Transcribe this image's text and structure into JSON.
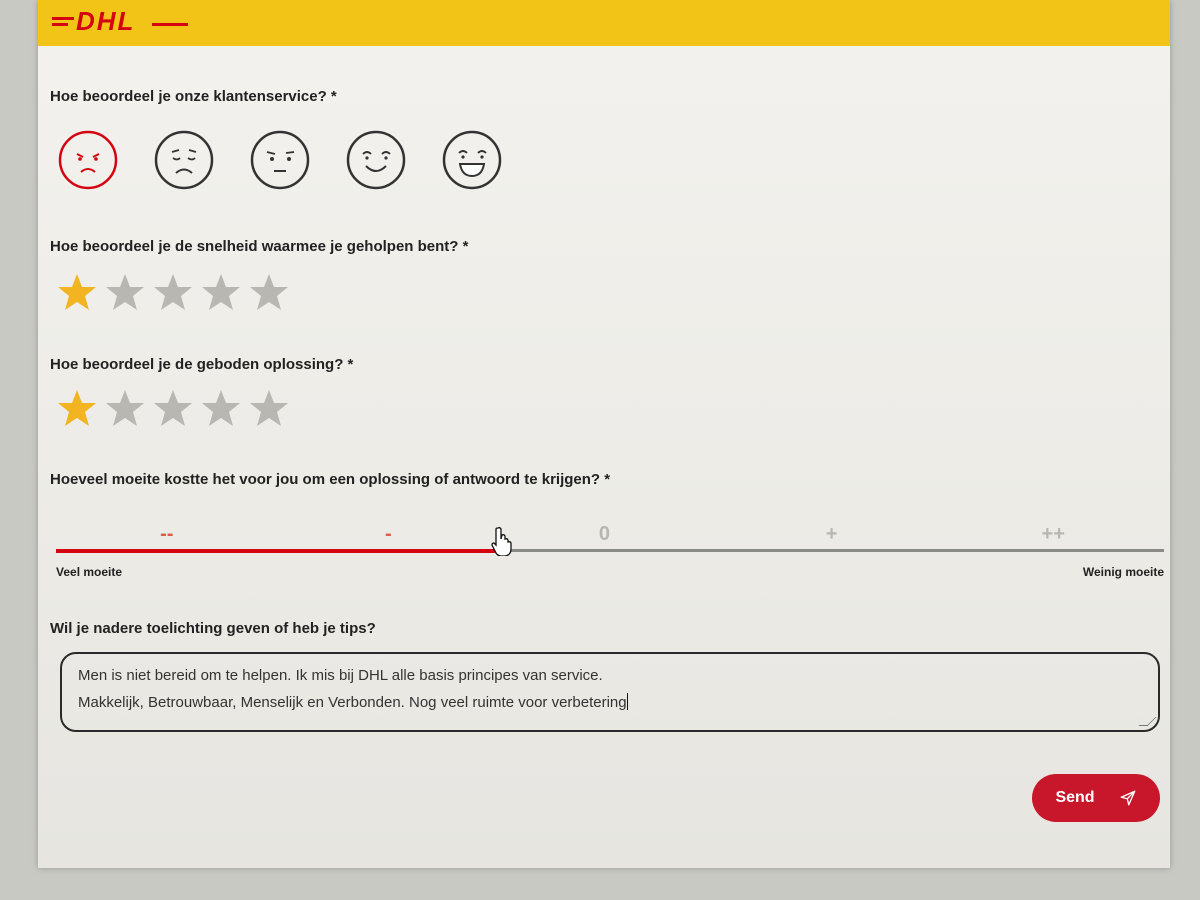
{
  "brand": {
    "logo_text": "DHL",
    "primary": "#f2c417",
    "accent": "#d40511"
  },
  "questions": {
    "q1": {
      "label": "Hoe beoordeel je onze klantenservice? *",
      "selected": 1,
      "options": [
        "very-sad-face-icon",
        "sad-face-icon",
        "neutral-face-icon",
        "happy-face-icon",
        "very-happy-face-icon"
      ]
    },
    "q2": {
      "label": "Hoe beoordeel je de snelheid waarmee je geholpen bent? *",
      "rating": 1,
      "max": 5
    },
    "q3": {
      "label": "Hoe beoordeel je de geboden oplossing? *",
      "rating": 1,
      "max": 5
    },
    "q4": {
      "label": "Hoeveel moeite kostte het voor jou om een oplossing of antwoord te krijgen? *",
      "marks": [
        "--",
        "-",
        "0",
        "+",
        "++"
      ],
      "selected_index": 1,
      "fill_fraction": 0.403,
      "left_label": "Veel moeite",
      "right_label": "Weinig moeite"
    },
    "q5": {
      "label": "Wil je nadere toelichting geven of heb je tips?",
      "value": "Men is niet bereid om te helpen. Ik mis bij DHL alle basis principes van service.\nMakkelijk, Betrouwbaar, Menselijk en Verbonden. Nog veel ruimte voor verbetering"
    }
  },
  "send_button": {
    "label": "Send",
    "icon": "paper-plane-icon"
  }
}
